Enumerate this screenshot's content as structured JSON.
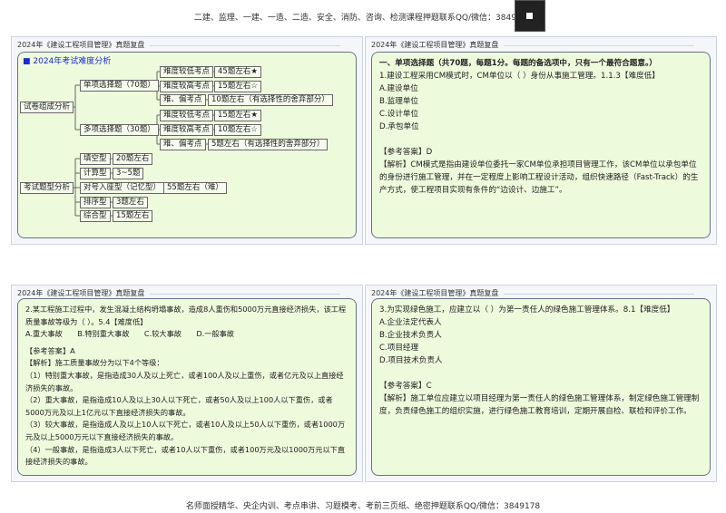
{
  "top_banner": "二建、监理、一建、一造、二造、安全、消防、咨询、检测课程押题联系QQ/微信：3849178",
  "footer": "名师面授精华、央企内训、考点串讲、习题模考、考前三页纸、绝密押题联系QQ/微信：3849178",
  "panel_header": "2024年《建设工程项目管理》真题复盘",
  "mindmap": {
    "title": "■ 2024年考试难度分析",
    "composition": "试卷组成分析",
    "single": "单项选择题（70题）",
    "multi": "多项选择题（30题）",
    "low": "难度较低考点",
    "high": "难度较高考点",
    "hard": "难、偏考点",
    "s_low": "45题左右★",
    "s_high": "15题左右☆",
    "s_hard": "10题左右（有选择性的舍弃部分）",
    "m_low": "15题左右★",
    "m_high": "10题左右☆",
    "m_hard": "5题左右（有选择性的舍弃部分）",
    "types": "考试题型分析",
    "t1": "填空型",
    "t1v": "20题左右",
    "t2": "计算型",
    "t2v": "3~5题",
    "t3": "对号入座型（记忆型）",
    "t3v": "55题左右（难）",
    "t4": "排序型",
    "t4v": "3题左右",
    "t5": "综合型",
    "t5v": "15题左右"
  },
  "q1": {
    "section": "一、单项选择题（共70题，每题1分。每题的备选项中，只有一个最符合题意。）",
    "stem": "1.建设工程采用CM模式时，CM单位以（ ）身份从事施工管理。1.1.3【难度低】",
    "options": [
      "A.建设单位",
      "B.监理单位",
      "C.设计单位",
      "D.承包单位"
    ],
    "answer": "【参考答案】D",
    "analysis": "【解析】CM模式是指由建设单位委托一家CM单位承担项目管理工作，该CM单位以承包单位的身份进行施工管理，并在一定程度上影响工程设计活动，组织快速路径（Fast-Track）的生产方式，使工程项目实现有条件的“边设计、边施工”。"
  },
  "q2": {
    "stem": "2.某工程施工过程中，发生混凝土结构坍塌事故，造成8人重伤和5000万元直接经济损失，该工程质量事故等级为（ ）。5.4【难度低】",
    "options": [
      "A.重大事故",
      "B.特别重大事故",
      "C.较大事故",
      "D.一般事故"
    ],
    "answer": "【参考答案】A",
    "analysis": [
      "【解析】施工质量事故分为以下4个等级：",
      "（1）特别重大事故，是指造成30人及以上死亡，或者100人及以上重伤，或者亿元及以上直接经济损失的事故。",
      "（2）重大事故，是指造成10人及以上30人以下死亡，或者50人及以上100人以下重伤，或者5000万元及以上1亿元以下直接经济损失的事故。",
      "（3）较大事故，是指造成人及以上10人以下死亡，或者10人及以上50人以下重伤，或者1000万元及以上5000万元以下直接经济损失的事故。",
      "（4）一般事故，是指造成3人以下死亡，或者10人以下重伤，或者100万元及以1000万元以下直接经济损失的事故。"
    ]
  },
  "q3": {
    "stem": "3.为实现绿色施工，应建立以（ ）为第一责任人的绿色施工管理体系。8.1【难度低】",
    "options": [
      "A.企业法定代表人",
      "B.企业技术负责人",
      "C.项目经理",
      "D.项目技术负责人"
    ],
    "answer": "【参考答案】C",
    "analysis": "【解析】施工单位应建立以项目经理为第一责任人的绿色施工管理体系，制定绿色施工管理制度，负责绿色施工的组织实施，进行绿色施工教育培训，定期开展自检、联检和评价工作。"
  }
}
